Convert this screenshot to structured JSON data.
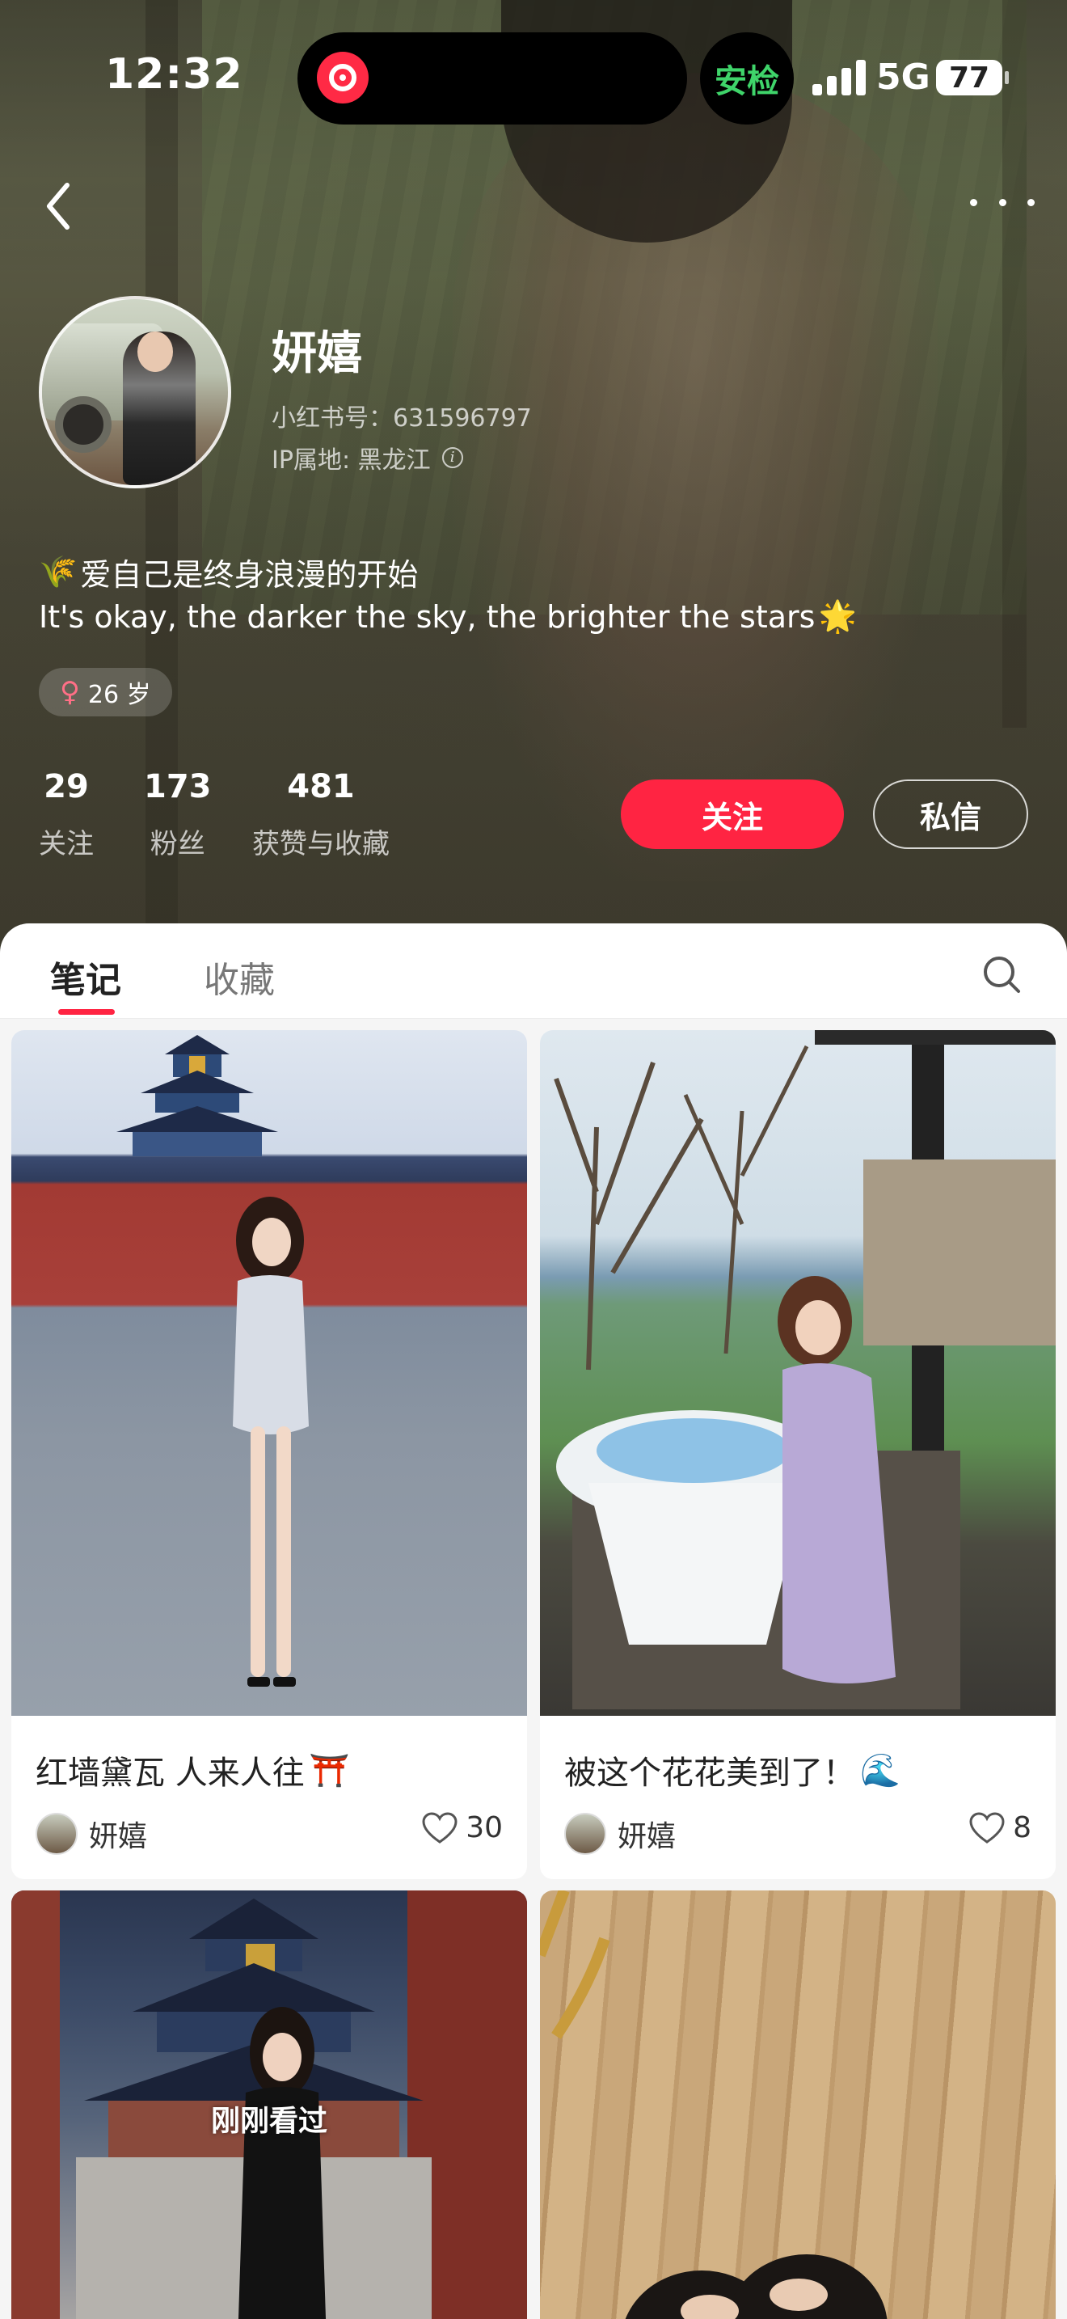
{
  "status_bar": {
    "time": "12:32",
    "badge": "安检",
    "network": "5G",
    "battery": "77"
  },
  "profile": {
    "nickname": "妍嬉",
    "red_id": "小红书号：631596797",
    "ip_location": "IP属地: 黑龙江",
    "bio_line1": "爱自己是终身浪漫的开始",
    "bio_line2": "It's okay, the darker the sky, the brighter the stars",
    "age_tag": "26 岁",
    "gender_symbol": "♀"
  },
  "stats": [
    {
      "value": "29",
      "label": "关注"
    },
    {
      "value": "173",
      "label": "粉丝"
    },
    {
      "value": "481",
      "label": "获赞与收藏"
    }
  ],
  "actions": {
    "follow": "关注",
    "message": "私信"
  },
  "tabs": {
    "notes": "笔记",
    "collections": "收藏"
  },
  "notes": [
    {
      "title": "红墙黛瓦 人来人往",
      "emoji": "⛩️",
      "author": "妍嬉",
      "likes": "30"
    },
    {
      "title": "被这个花花美到了！",
      "emoji": "🌊",
      "author": "妍嬉",
      "likes": "8"
    },
    {
      "overlay": "刚刚看过"
    },
    {}
  ],
  "colors": {
    "accent": "#ff2442",
    "header_bg": "#4b4a3a",
    "island_app": "#ff2a45",
    "badge_green": "#3fd46a"
  },
  "icons": [
    "back-chevron-icon",
    "more-dots-icon",
    "info-icon",
    "search-icon",
    "heart-icon",
    "wheat-icon",
    "star-icon"
  ]
}
